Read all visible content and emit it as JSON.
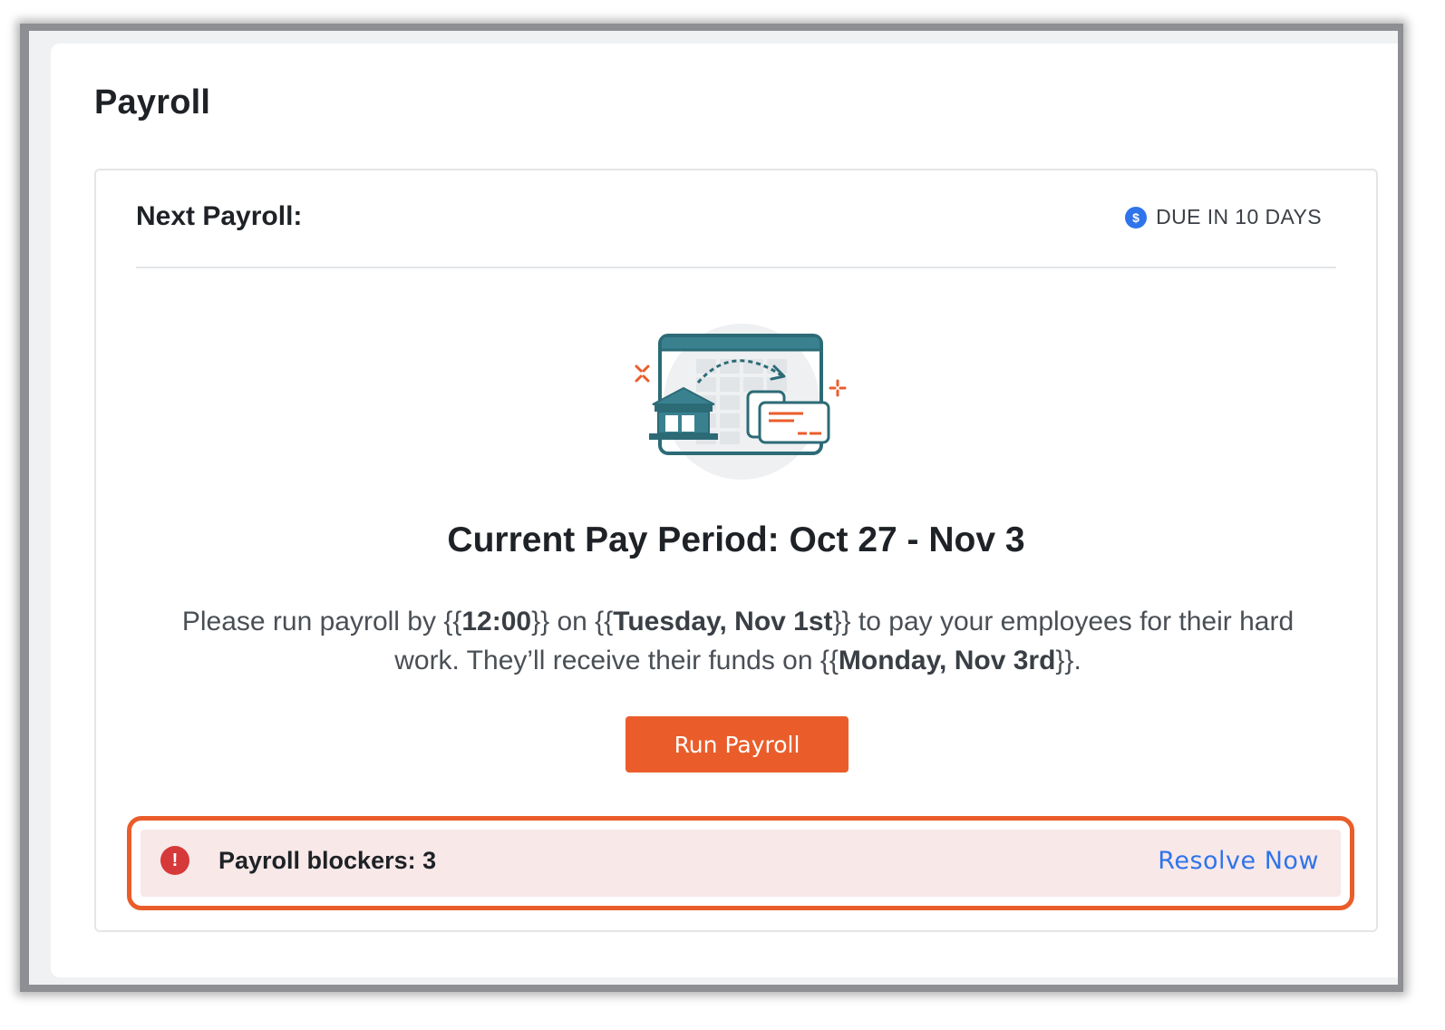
{
  "page": {
    "title": "Payroll"
  },
  "next_payroll": {
    "header_title": "Next Payroll:",
    "due_badge": "DUE IN 10 DAYS",
    "badge_icon": "dollar-circle-icon",
    "badge_color": "#2f74ea"
  },
  "pay_period": {
    "title": "Current Pay Period: Oct 27 - Nov 3"
  },
  "instructions": {
    "part1": "Please run payroll by {{",
    "time": "12:00",
    "part2": "}} on {{",
    "deadline": "Tuesday, Nov 1st",
    "part3": "}} to pay your employees for their hard work. They’ll receive their funds on {{",
    "funds_date": "Monday, Nov 3rd",
    "part4": "}}."
  },
  "actions": {
    "run_payroll_label": "Run Payroll",
    "run_payroll_color": "#ea5d2b"
  },
  "blockers": {
    "label": "Payroll blockers: 3",
    "resolve_label": "Resolve Now",
    "alert_icon": "exclamation-circle-icon",
    "alert_color": "#d63939",
    "link_color": "#2f74ea",
    "highlight_color": "#ea5d2b"
  },
  "illustration": {
    "icon": "bank-to-card-transfer-illustration"
  }
}
